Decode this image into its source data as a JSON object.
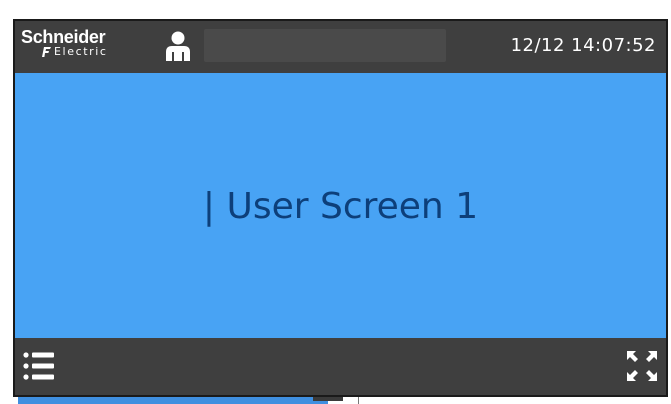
{
  "header": {
    "logo": {
      "brand": "Schneider",
      "sub": "Electric"
    },
    "user_icon": "user-icon",
    "datetime": "12/12 14:07:52"
  },
  "screen": {
    "title": "| User Screen 1",
    "background": "#48a3f4",
    "text_color": "#0d3f7a"
  },
  "footer": {
    "menu_icon": "list-menu-icon",
    "fullscreen_icon": "expand-arrows-icon"
  },
  "colors": {
    "bar": "#3f3f3f",
    "accent": "#48a3f4"
  }
}
